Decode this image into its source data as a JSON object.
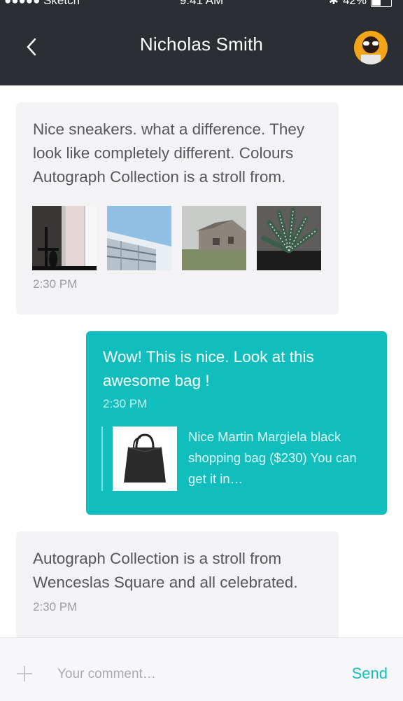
{
  "status_bar": {
    "carrier": "●●●●● Sketch",
    "time": "9:41 AM",
    "battery": "42%",
    "battery_level": 0.42
  },
  "header": {
    "title": "Nicholas Smith",
    "back_icon": "chevron-left-icon",
    "avatar_icon": "avatar"
  },
  "messages": [
    {
      "direction": "incoming",
      "text": "Nice sneakers. what a difference. They look like completely different. Colours Autograph Collection is a stroll from.",
      "attachments": [
        "interior-photo",
        "building-photo",
        "barn-photo",
        "succulent-photo"
      ],
      "time": "2:30 PM"
    },
    {
      "direction": "outgoing",
      "text": "Wow! This is nice. Look at this awesome bag !",
      "time": "2:30 PM",
      "product": {
        "image": "black-bag-photo",
        "description": "Nice Martin Margiela black shopping bag ($230) You can get it in…"
      }
    },
    {
      "direction": "incoming",
      "text": "Autograph Collection is a stroll from Wenceslas Square and all celebrated.",
      "time": "2:30 PM"
    }
  ],
  "composer": {
    "placeholder": "Your comment…",
    "send_label": "Send",
    "add_icon": "plus-icon"
  },
  "colors": {
    "header_bg": "#2b2f33",
    "accent": "#10bfbd",
    "incoming_bg": "#f3f3f6"
  }
}
